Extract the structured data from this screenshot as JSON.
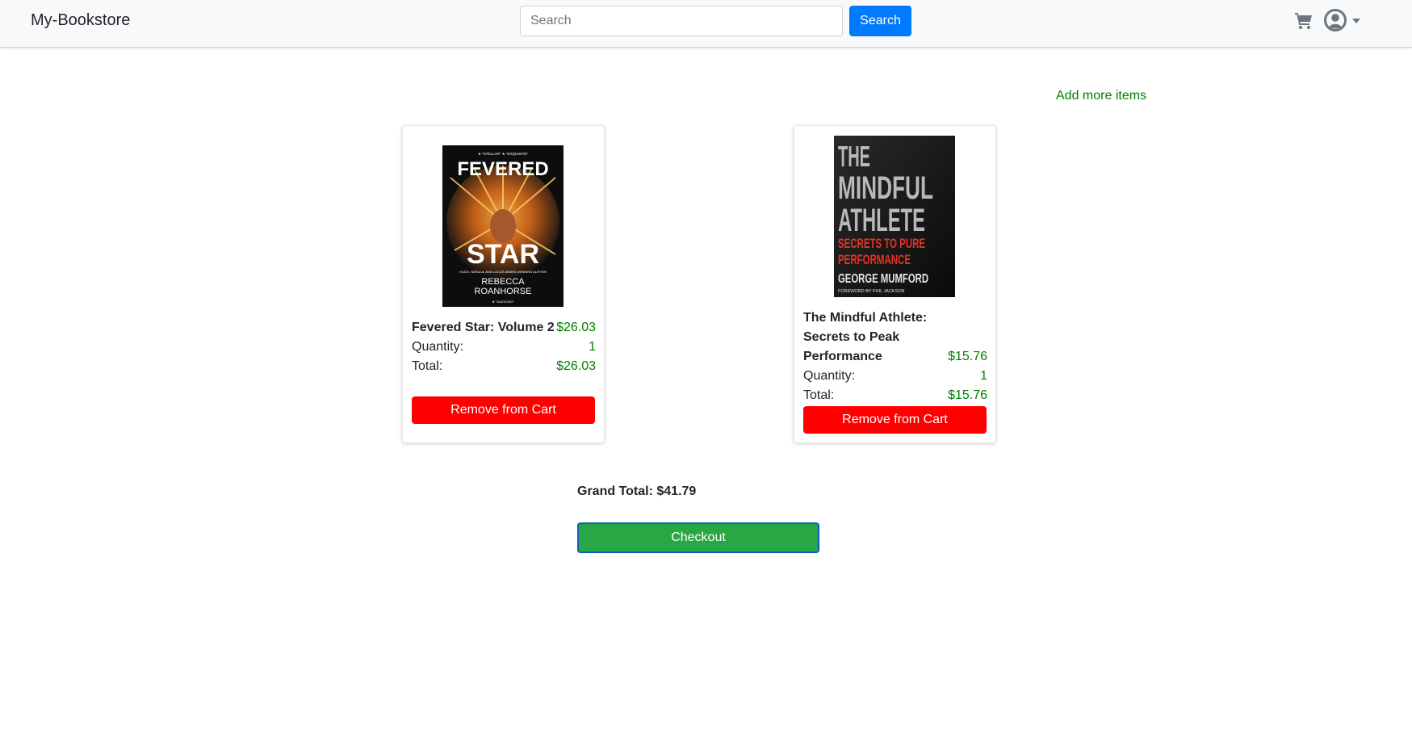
{
  "header": {
    "brand": "My-Bookstore",
    "search_placeholder": "Search",
    "search_button": "Search",
    "cart_icon": "shopping-cart-icon",
    "user_icon": "user-circle-icon"
  },
  "add_more_label": "Add more items",
  "cart": {
    "items": [
      {
        "title": "Fevered Star: Volume 2",
        "price": "$26.03",
        "quantity_label": "Quantity:",
        "quantity": "1",
        "total_label": "Total:",
        "total": "$26.03",
        "remove_label": "Remove from Cart",
        "cover": {
          "top_quotes": "★ \"STELLAR\"        ★ \"EXQUISITE\"",
          "line1": "FEVERED",
          "line2": "STAR",
          "tagline": "HUGO, NEBULA, AND LOCUS AWARD-WINNING AUTHOR",
          "author1": "REBECCA",
          "author2": "ROANHORSE",
          "bottom_quote": "★ \"DAZZLING\""
        }
      },
      {
        "title": "The Mindful Athlete: Secrets to Peak Performance",
        "price": "$15.76",
        "quantity_label": "Quantity:",
        "quantity": "1",
        "total_label": "Total:",
        "total": "$15.76",
        "remove_label": "Remove from Cart",
        "cover": {
          "line1": "THE",
          "line2": "MINDFUL",
          "line3": "ATHLETE",
          "sub1": "SECRETS TO PURE",
          "sub2": "PERFORMANCE",
          "author": "GEORGE MUMFORD",
          "foreword": "FOREWORD BY PHIL JACKSON"
        }
      }
    ],
    "grand_total": "Grand Total: $41.79",
    "checkout_label": "Checkout"
  },
  "colors": {
    "primary": "#007bff",
    "success_text": "#008000",
    "danger": "#ff0000",
    "checkout": "#28a745",
    "navbar_bg": "#f8f9fa"
  }
}
